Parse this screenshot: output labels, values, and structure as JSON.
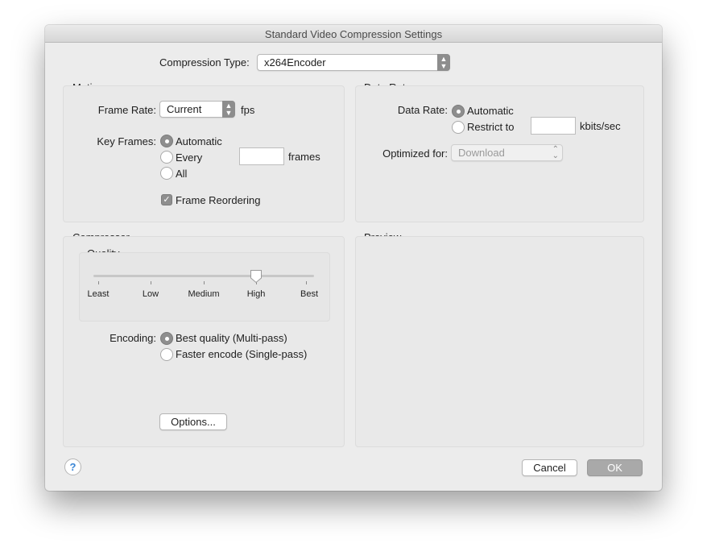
{
  "window": {
    "title": "Standard Video Compression Settings"
  },
  "compression_type": {
    "label": "Compression Type:",
    "value": "x264Encoder"
  },
  "motion": {
    "title": "Motion",
    "frame_rate_label": "Frame Rate:",
    "frame_rate_value": "Current",
    "frame_rate_unit": "fps",
    "key_frames_label": "Key Frames:",
    "key_frames_options": [
      "Automatic",
      "Every",
      "All"
    ],
    "key_frames_selected": "Automatic",
    "key_frames_every_value": "",
    "key_frames_unit": "frames",
    "frame_reordering_label": "Frame Reordering",
    "frame_reordering_checked": true
  },
  "data_rate": {
    "title": "Data Rate",
    "label": "Data Rate:",
    "options": [
      "Automatic",
      "Restrict to"
    ],
    "selected": "Automatic",
    "restrict_value": "",
    "unit": "kbits/sec",
    "optimized_label": "Optimized for:",
    "optimized_value": "Download"
  },
  "compressor": {
    "title": "Compressor",
    "quality": {
      "title": "Quality",
      "ticks": [
        "Least",
        "Low",
        "Medium",
        "High",
        "Best"
      ],
      "selected": "High",
      "level_fraction": 0.75
    },
    "encoding_label": "Encoding:",
    "encoding_options": [
      "Best quality (Multi-pass)",
      "Faster encode (Single-pass)"
    ],
    "encoding_selected": "Best quality (Multi-pass)",
    "options_button": "Options..."
  },
  "preview": {
    "title": "Preview"
  },
  "footer": {
    "help_icon": "?",
    "cancel_label": "Cancel",
    "ok_label": "OK"
  }
}
